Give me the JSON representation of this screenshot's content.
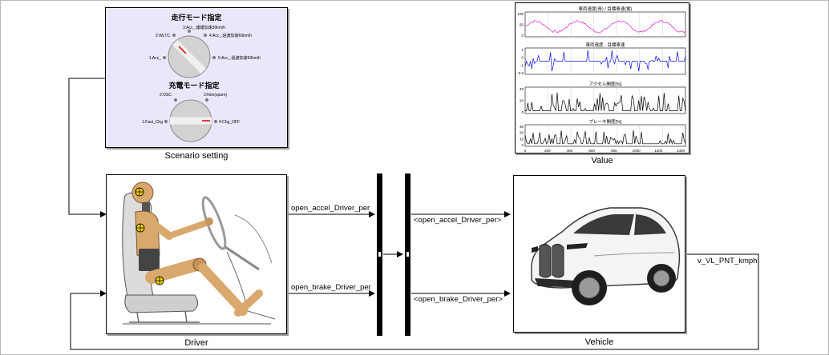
{
  "blocks": {
    "scenario": {
      "caption": "Scenario setting",
      "drive_mode": {
        "title": "走行モード指定",
        "options": [
          "1:Acc_",
          "2:WLTC",
          "3:Acc_:緩緩加速30km/h",
          "4:Acc_:過渡加速60km/h",
          "5:Acc_:過渡加速90km/h"
        ]
      },
      "charge_mode": {
        "title": "充電モード指定",
        "options": [
          "1:Fast_Chg",
          "2:OSC",
          "3:Non(spare)",
          "4:Chg_OFF"
        ]
      }
    },
    "value": {
      "caption": "Value",
      "plots": [
        {
          "title": "車両速度(青) / 目標車速(紫)",
          "yticks": [
            "100",
            "50",
            "0"
          ],
          "color": "#e020e0"
        },
        {
          "title": "車両速度 - 目標車速",
          "yticks": [
            "1",
            "0",
            "-1",
            "-0.0"
          ],
          "color": "#1010e0"
        },
        {
          "title": "アクセル開度[%]",
          "yticks": [
            "40",
            "20",
            "0"
          ],
          "color": "#000000"
        },
        {
          "title": "ブレーキ開度[%]",
          "yticks": [
            "30",
            "20",
            "10",
            "0"
          ],
          "color": "#000000"
        }
      ],
      "xticks": [
        "0",
        "200",
        "400",
        "600",
        "800",
        "1000",
        "1200",
        "1400"
      ]
    },
    "driver": {
      "caption": "Driver"
    },
    "vehicle": {
      "caption": "Vehicle"
    }
  },
  "signals": {
    "accel": "open_accel_Driver_per",
    "brake": "open_brake_Driver_per",
    "accel_bus": "<open_accel_Driver_per>",
    "brake_bus": "<open_brake_Driver_per>",
    "speed": "v_VL_PNT_kmph"
  }
}
